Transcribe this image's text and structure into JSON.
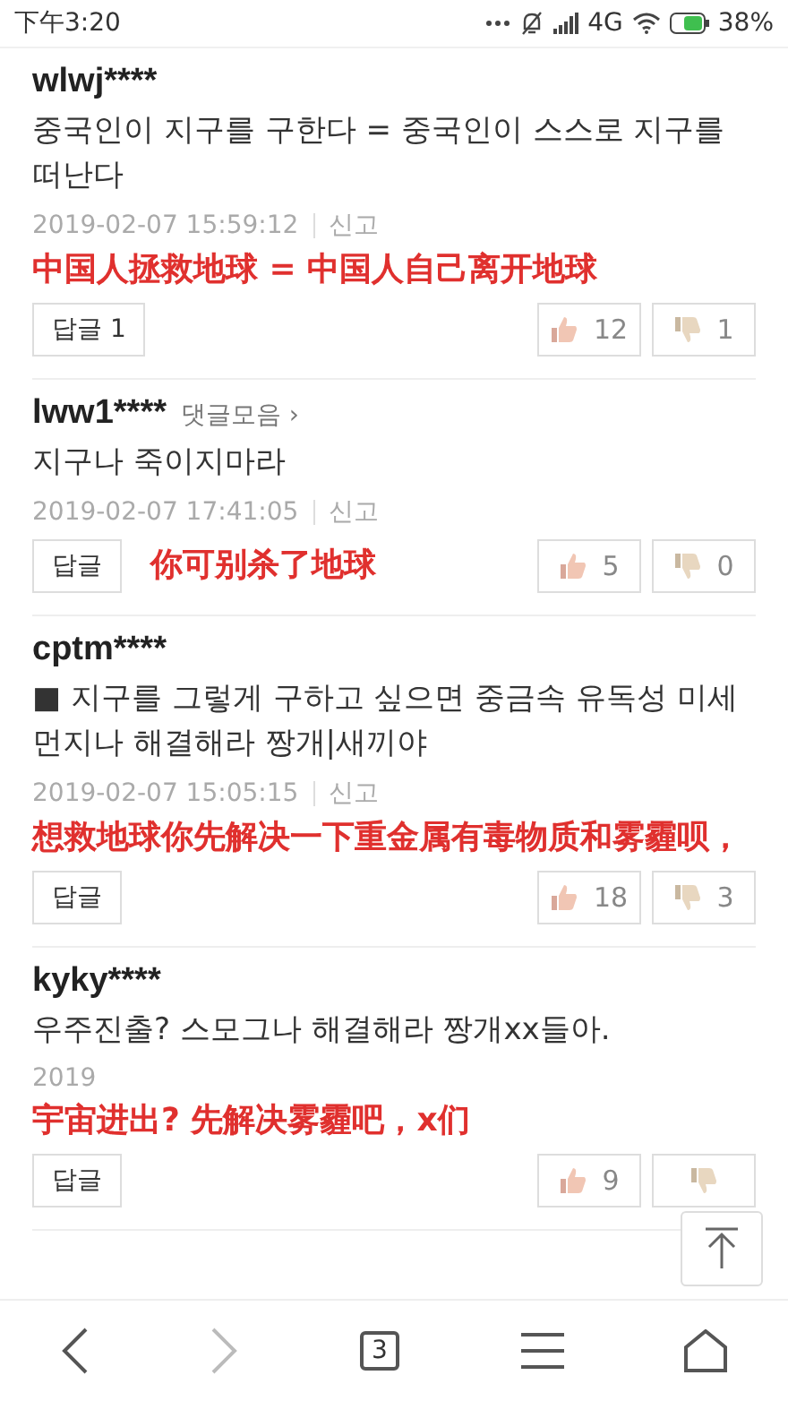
{
  "status_bar": {
    "time": "下午3:20",
    "network": "4G",
    "battery": "38%"
  },
  "comments": [
    {
      "user": "wlwj****",
      "text": "중국인이 지구를 구한다 = 중국인이 스스로 지구를 떠난다",
      "date": "2019-02-07 15:59:12",
      "report": "신고",
      "reply": "답글 1",
      "likes": "12",
      "dislikes": "1",
      "annotation": {
        "kind": "overlay",
        "text": "中国人拯救地球 = 中国人自己离开地球"
      }
    },
    {
      "user": "lww1****",
      "link": "댓글모음 ›",
      "text": "지구나 죽이지마라",
      "date": "2019-02-07 17:41:05",
      "report": "신고",
      "reply": "답글",
      "likes": "5",
      "dislikes": "0",
      "annotation": {
        "kind": "inline",
        "text": "你可别杀了地球"
      }
    },
    {
      "user": "cptm****",
      "text": "■ 지구를 그렇게 구하고 싶으면 중금속 유독성 미세먼지나 해결해라 짱개|새끼야",
      "date": "2019-02-07 15:05:15",
      "report": "신고",
      "reply": "답글",
      "likes": "18",
      "dislikes": "3",
      "annotation": {
        "kind": "overlay",
        "text": "想救地球你先解决一下重金属有毒物质和雾霾呗，"
      }
    },
    {
      "user": "kyky****",
      "text": "우주진출? 스모그나 해결해라 짱개xx들아.",
      "date": "2019",
      "reply": "답글",
      "likes": "9",
      "annotation": {
        "kind": "overlay",
        "text": "宇宙进出? 先解决雾霾吧，x们"
      }
    }
  ],
  "nav": {
    "tab_count": "3",
    "forward_disabled": true
  }
}
